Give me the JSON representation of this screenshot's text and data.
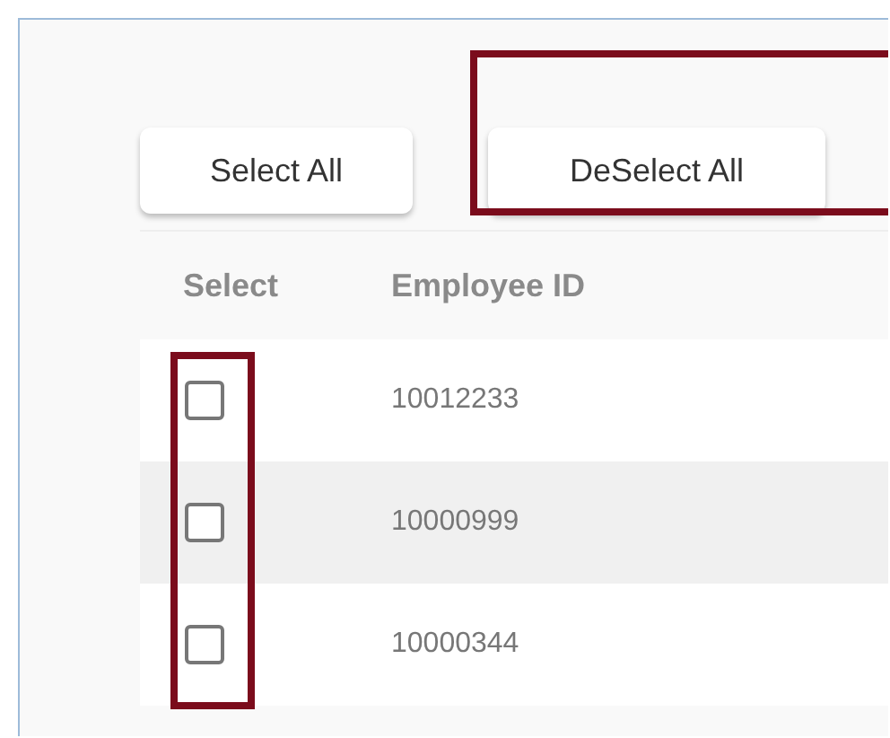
{
  "buttons": [
    {
      "label": "Select All",
      "highlighted": false
    },
    {
      "label": "DeSelect All",
      "highlighted": true
    }
  ],
  "table": {
    "columns": [
      "Select",
      "Employee ID"
    ],
    "checkbox_column_highlighted": true,
    "rows": [
      {
        "checked": false,
        "employee_id": "10012233"
      },
      {
        "checked": false,
        "employee_id": "10000999"
      },
      {
        "checked": false,
        "employee_id": "10000344"
      }
    ]
  }
}
